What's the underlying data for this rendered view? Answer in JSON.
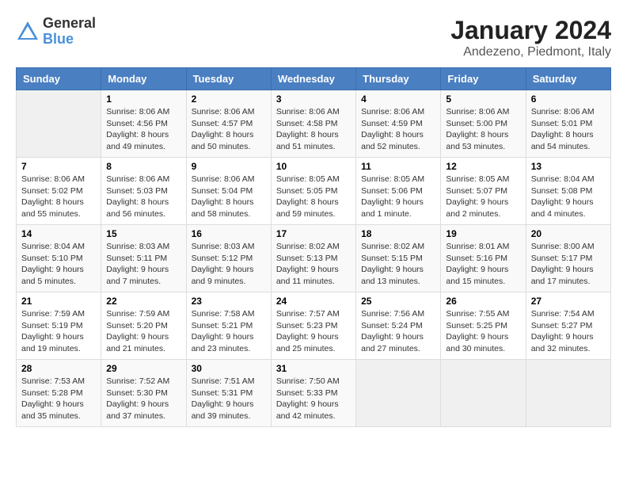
{
  "logo": {
    "general": "General",
    "blue": "Blue"
  },
  "title": {
    "month_year": "January 2024",
    "location": "Andezeno, Piedmont, Italy"
  },
  "headers": [
    "Sunday",
    "Monday",
    "Tuesday",
    "Wednesday",
    "Thursday",
    "Friday",
    "Saturday"
  ],
  "weeks": [
    [
      {
        "day": "",
        "info": ""
      },
      {
        "day": "1",
        "info": "Sunrise: 8:06 AM\nSunset: 4:56 PM\nDaylight: 8 hours\nand 49 minutes."
      },
      {
        "day": "2",
        "info": "Sunrise: 8:06 AM\nSunset: 4:57 PM\nDaylight: 8 hours\nand 50 minutes."
      },
      {
        "day": "3",
        "info": "Sunrise: 8:06 AM\nSunset: 4:58 PM\nDaylight: 8 hours\nand 51 minutes."
      },
      {
        "day": "4",
        "info": "Sunrise: 8:06 AM\nSunset: 4:59 PM\nDaylight: 8 hours\nand 52 minutes."
      },
      {
        "day": "5",
        "info": "Sunrise: 8:06 AM\nSunset: 5:00 PM\nDaylight: 8 hours\nand 53 minutes."
      },
      {
        "day": "6",
        "info": "Sunrise: 8:06 AM\nSunset: 5:01 PM\nDaylight: 8 hours\nand 54 minutes."
      }
    ],
    [
      {
        "day": "7",
        "info": "Sunrise: 8:06 AM\nSunset: 5:02 PM\nDaylight: 8 hours\nand 55 minutes."
      },
      {
        "day": "8",
        "info": "Sunrise: 8:06 AM\nSunset: 5:03 PM\nDaylight: 8 hours\nand 56 minutes."
      },
      {
        "day": "9",
        "info": "Sunrise: 8:06 AM\nSunset: 5:04 PM\nDaylight: 8 hours\nand 58 minutes."
      },
      {
        "day": "10",
        "info": "Sunrise: 8:05 AM\nSunset: 5:05 PM\nDaylight: 8 hours\nand 59 minutes."
      },
      {
        "day": "11",
        "info": "Sunrise: 8:05 AM\nSunset: 5:06 PM\nDaylight: 9 hours\nand 1 minute."
      },
      {
        "day": "12",
        "info": "Sunrise: 8:05 AM\nSunset: 5:07 PM\nDaylight: 9 hours\nand 2 minutes."
      },
      {
        "day": "13",
        "info": "Sunrise: 8:04 AM\nSunset: 5:08 PM\nDaylight: 9 hours\nand 4 minutes."
      }
    ],
    [
      {
        "day": "14",
        "info": "Sunrise: 8:04 AM\nSunset: 5:10 PM\nDaylight: 9 hours\nand 5 minutes."
      },
      {
        "day": "15",
        "info": "Sunrise: 8:03 AM\nSunset: 5:11 PM\nDaylight: 9 hours\nand 7 minutes."
      },
      {
        "day": "16",
        "info": "Sunrise: 8:03 AM\nSunset: 5:12 PM\nDaylight: 9 hours\nand 9 minutes."
      },
      {
        "day": "17",
        "info": "Sunrise: 8:02 AM\nSunset: 5:13 PM\nDaylight: 9 hours\nand 11 minutes."
      },
      {
        "day": "18",
        "info": "Sunrise: 8:02 AM\nSunset: 5:15 PM\nDaylight: 9 hours\nand 13 minutes."
      },
      {
        "day": "19",
        "info": "Sunrise: 8:01 AM\nSunset: 5:16 PM\nDaylight: 9 hours\nand 15 minutes."
      },
      {
        "day": "20",
        "info": "Sunrise: 8:00 AM\nSunset: 5:17 PM\nDaylight: 9 hours\nand 17 minutes."
      }
    ],
    [
      {
        "day": "21",
        "info": "Sunrise: 7:59 AM\nSunset: 5:19 PM\nDaylight: 9 hours\nand 19 minutes."
      },
      {
        "day": "22",
        "info": "Sunrise: 7:59 AM\nSunset: 5:20 PM\nDaylight: 9 hours\nand 21 minutes."
      },
      {
        "day": "23",
        "info": "Sunrise: 7:58 AM\nSunset: 5:21 PM\nDaylight: 9 hours\nand 23 minutes."
      },
      {
        "day": "24",
        "info": "Sunrise: 7:57 AM\nSunset: 5:23 PM\nDaylight: 9 hours\nand 25 minutes."
      },
      {
        "day": "25",
        "info": "Sunrise: 7:56 AM\nSunset: 5:24 PM\nDaylight: 9 hours\nand 27 minutes."
      },
      {
        "day": "26",
        "info": "Sunrise: 7:55 AM\nSunset: 5:25 PM\nDaylight: 9 hours\nand 30 minutes."
      },
      {
        "day": "27",
        "info": "Sunrise: 7:54 AM\nSunset: 5:27 PM\nDaylight: 9 hours\nand 32 minutes."
      }
    ],
    [
      {
        "day": "28",
        "info": "Sunrise: 7:53 AM\nSunset: 5:28 PM\nDaylight: 9 hours\nand 35 minutes."
      },
      {
        "day": "29",
        "info": "Sunrise: 7:52 AM\nSunset: 5:30 PM\nDaylight: 9 hours\nand 37 minutes."
      },
      {
        "day": "30",
        "info": "Sunrise: 7:51 AM\nSunset: 5:31 PM\nDaylight: 9 hours\nand 39 minutes."
      },
      {
        "day": "31",
        "info": "Sunrise: 7:50 AM\nSunset: 5:33 PM\nDaylight: 9 hours\nand 42 minutes."
      },
      {
        "day": "",
        "info": ""
      },
      {
        "day": "",
        "info": ""
      },
      {
        "day": "",
        "info": ""
      }
    ]
  ]
}
